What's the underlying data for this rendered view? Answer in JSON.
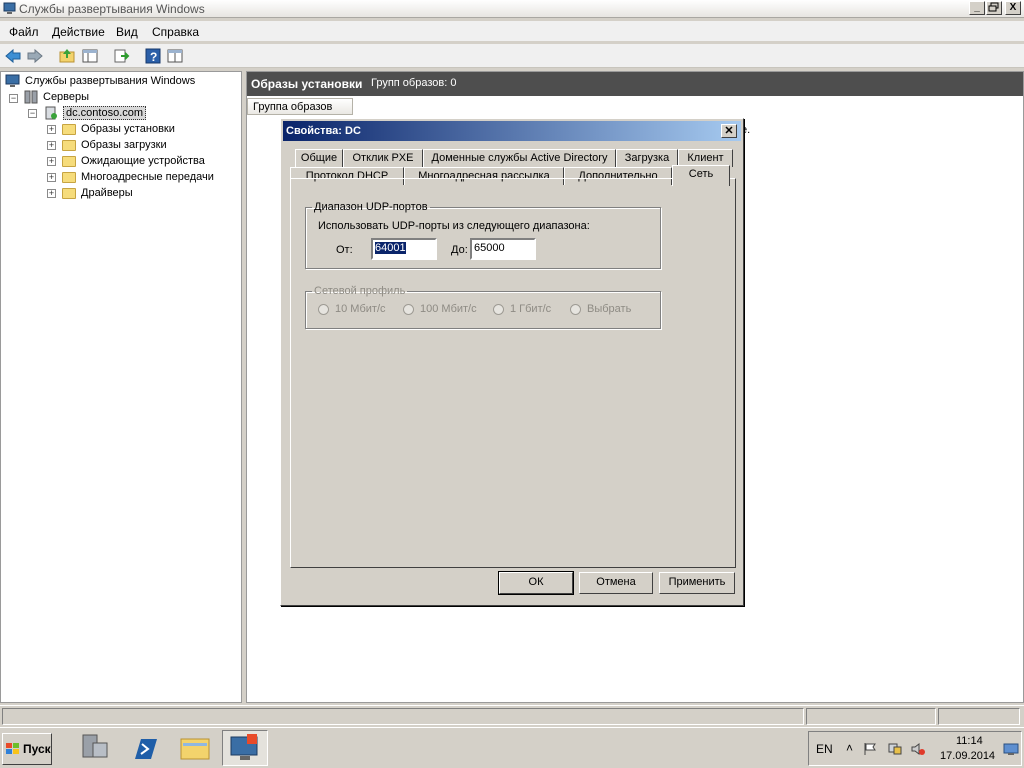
{
  "window": {
    "title": "Службы развертывания Windows",
    "controls": {
      "minimize": "_",
      "maximize": "🗗",
      "close": "X"
    }
  },
  "menu": [
    "Файл",
    "Действие",
    "Вид",
    "Справка"
  ],
  "toolbar_icons": [
    "back-icon",
    "forward-icon",
    "up-folder-icon",
    "show-tree-icon",
    "export-icon",
    "help-icon",
    "properties-icon"
  ],
  "tree": {
    "root": "Службы развертывания Windows",
    "servers": "Серверы",
    "server": "dc.contoso.com",
    "children": [
      "Образы установки",
      "Образы загрузки",
      "Ожидающие устройства",
      "Многоадресные передачи",
      "Драйверы"
    ]
  },
  "right_pane": {
    "header_title": "Образы установки",
    "header_count": "Групп образов: 0",
    "column": "Группа образов",
    "partial_text": "е."
  },
  "dialog": {
    "title": "Свойства: DC",
    "tabs_row1": [
      "Общие",
      "Отклик PXE",
      "Доменные службы Active Directory",
      "Загрузка",
      "Клиент"
    ],
    "tabs_row2": [
      "Протокол DHCP",
      "Многоадресная рассылка",
      "Дополнительно",
      "Сеть"
    ],
    "active_tab": "Сеть",
    "udp_group": {
      "legend": "Диапазон UDP-портов",
      "description": "Использовать UDP-порты из следующего диапазона:",
      "from_label": "От:",
      "from_value": "64001",
      "to_label": "До:",
      "to_value": "65000"
    },
    "profile_group": {
      "legend": "Сетевой профиль",
      "options": [
        "10 Мбит/с",
        "100 Мбит/с",
        "1 Гбит/с",
        "Выбрать"
      ]
    },
    "buttons": {
      "ok": "ОК",
      "cancel": "Отмена",
      "apply": "Применить"
    }
  },
  "taskbar": {
    "start": "Пуск",
    "apps": [
      "server-manager-icon",
      "powershell-icon",
      "explorer-icon",
      "wds-icon"
    ],
    "lang": "EN",
    "time": "11:14",
    "date": "17.09.2014"
  }
}
